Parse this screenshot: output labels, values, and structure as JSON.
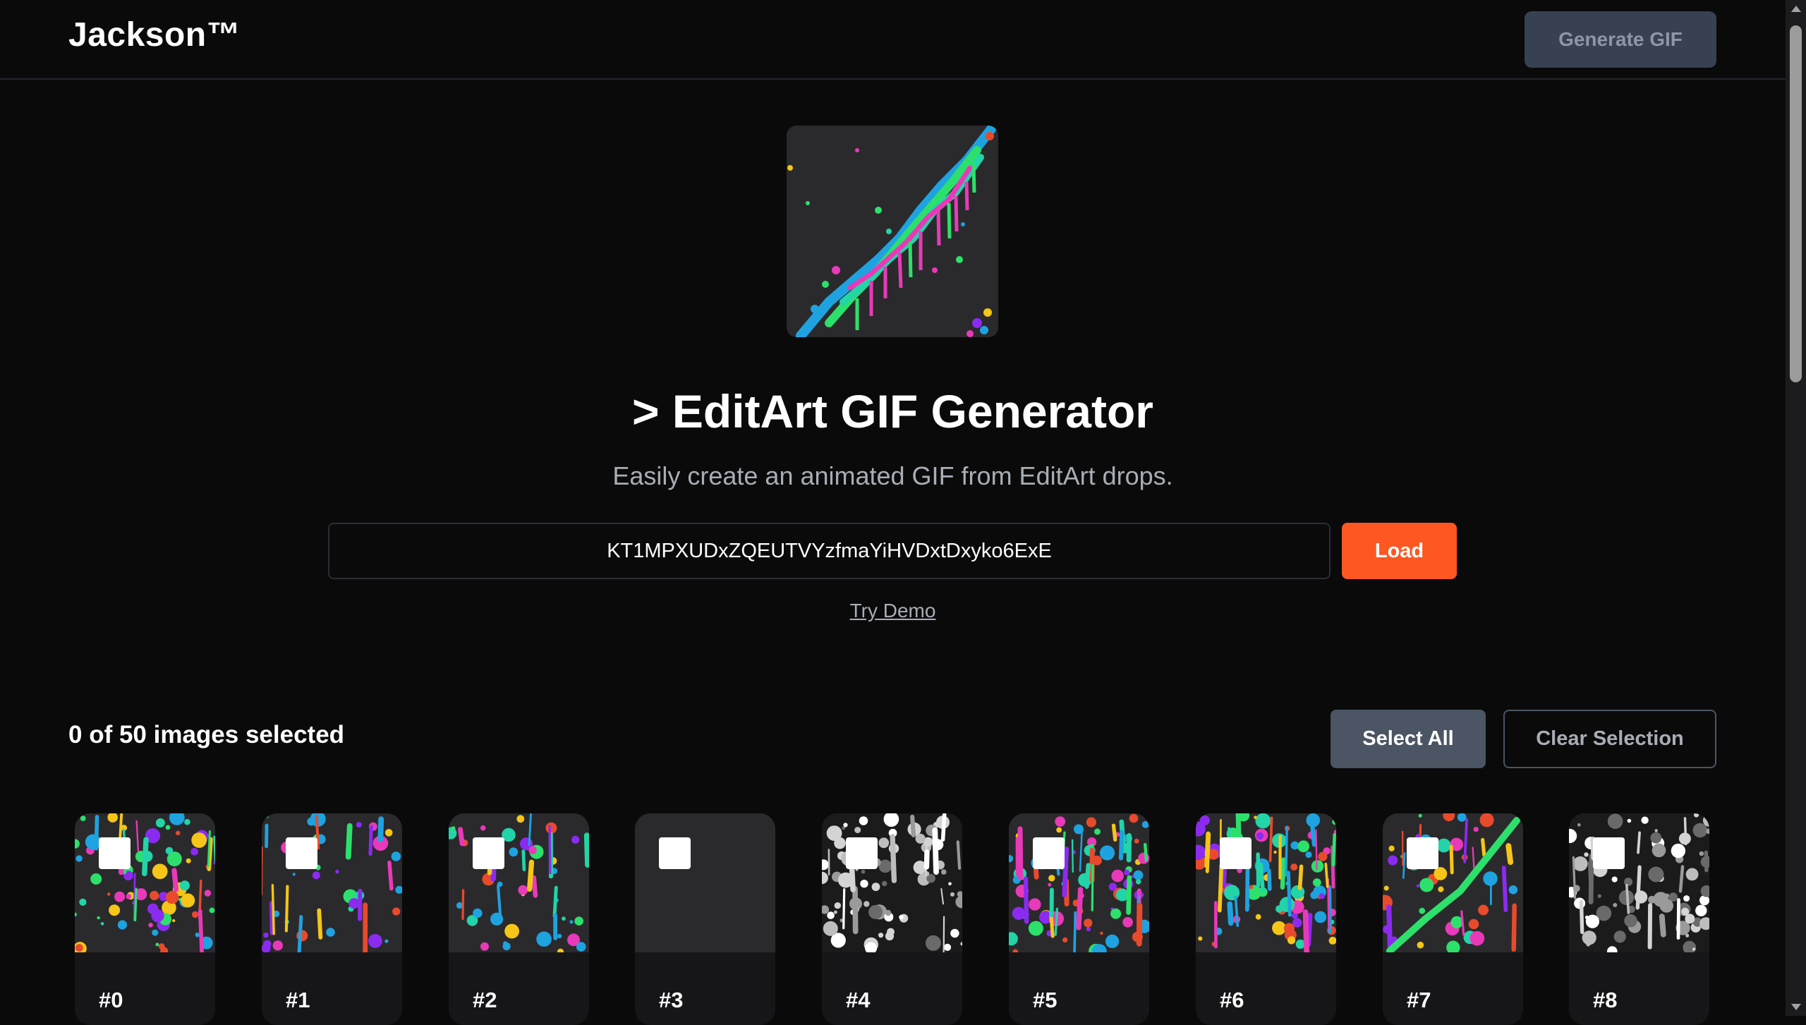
{
  "header": {
    "brand": "Jackson™",
    "generate_label": "Generate GIF"
  },
  "hero": {
    "title": "> EditArt GIF Generator",
    "subtitle": "Easily create an animated GIF from EditArt drops.",
    "address_value": "KT1MPXUDxZQEUTVYzfmaYiHVDxtDxyko6ExE",
    "load_label": "Load",
    "demo_label": "Try Demo"
  },
  "selection": {
    "count_text": "0 of 50 images selected",
    "select_all_label": "Select All",
    "clear_label": "Clear Selection"
  },
  "cards": [
    {
      "label": "#0",
      "style": "rainbow-dense"
    },
    {
      "label": "#1",
      "style": "rainbow-sparse"
    },
    {
      "label": "#2",
      "style": "rainbow-scatter"
    },
    {
      "label": "#3",
      "style": "blank"
    },
    {
      "label": "#4",
      "style": "grayscale"
    },
    {
      "label": "#5",
      "style": "rainbow-drip"
    },
    {
      "label": "#6",
      "style": "rainbow-drip"
    },
    {
      "label": "#7",
      "style": "rainbow-diagonal"
    },
    {
      "label": "#8",
      "style": "grayscale"
    }
  ]
}
